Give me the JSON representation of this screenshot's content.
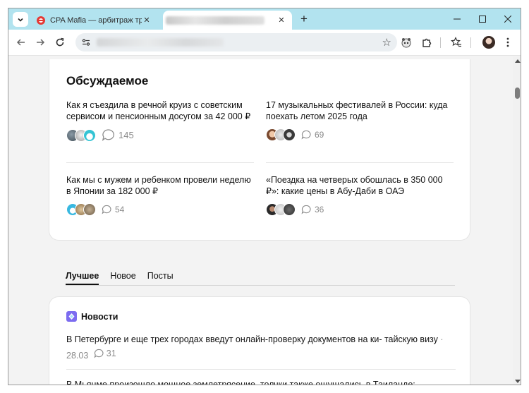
{
  "browser": {
    "tabs": [
      {
        "title": "CPA Mafia — арбитраж трафика",
        "active": false
      },
      {
        "title": "",
        "active": true
      }
    ],
    "new_tab_label": "+",
    "window_controls": {
      "minimize": "—",
      "maximize": "☐",
      "close": "✕"
    },
    "tab_close": "✕",
    "url": ""
  },
  "discussed": {
    "title": "Обсуждаемое",
    "articles": [
      {
        "title": "Как я съездила в речной круиз с советским сервисом и пенсионным досугом за 42 000 ₽",
        "comments": "145"
      },
      {
        "title": "17 музыкальных фестивалей в России: куда поехать летом 2025 года",
        "comments": "69"
      },
      {
        "title": "Как мы с мужем и ребенком провели неделю в Японии за 182 000 ₽",
        "comments": "54"
      },
      {
        "title": "«Поездка на четверых обошлась в 350 000 ₽»: какие цены в Абу-Даби в ОАЭ",
        "comments": "36"
      }
    ]
  },
  "feed_tabs": [
    {
      "label": "Лучшее",
      "active": true
    },
    {
      "label": "Новое",
      "active": false
    },
    {
      "label": "Посты",
      "active": false
    }
  ],
  "news": {
    "title": "Новости",
    "items": [
      {
        "text": "В Петербурге и еще трех городах введут онлайн-проверку документов на ки- тайскую визу",
        "date": "· 28.03",
        "comments": "31"
      },
      {
        "text": "В Мьянме произошло мощное землетрясение, толчки также ощущались в Таиланде:",
        "date": "",
        "comments": ""
      }
    ]
  },
  "colors": {
    "tabstrip": "#b2e3ef",
    "toolbar": "#ffffff",
    "page_bg": "#f3f3f3",
    "card_bg": "#ffffff",
    "muted_text": "#8a8a8a"
  },
  "icons": {
    "tab_favicon": "cpa-mafia-icon",
    "news_icon": "news-diamond-icon",
    "comment": "comment-bubble-icon"
  }
}
